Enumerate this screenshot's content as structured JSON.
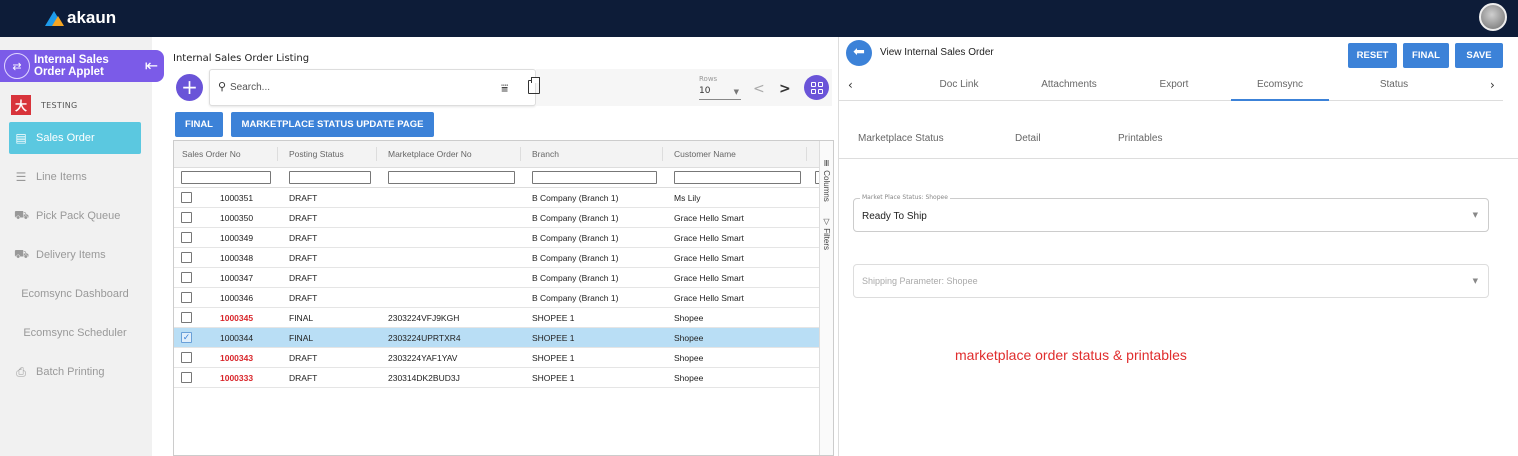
{
  "brand": {
    "name": "akaun"
  },
  "sidebar": {
    "applet_title": "Internal Sales Order Applet",
    "org_label": "TESTING",
    "items": [
      {
        "label": "Sales Order",
        "icon": "document-icon",
        "active": true
      },
      {
        "label": "Line Items",
        "icon": "list-icon"
      },
      {
        "label": "Pick Pack Queue",
        "icon": "truck-icon"
      },
      {
        "label": "Delivery Items",
        "icon": "truck-icon"
      },
      {
        "label": "Ecomsync Dashboard"
      },
      {
        "label": "Ecomsync Scheduler"
      },
      {
        "label": "Batch Printing",
        "icon": "printer-icon"
      }
    ]
  },
  "listing": {
    "title": "Internal Sales Order Listing",
    "search_placeholder": "Search...",
    "rows_label": "Rows",
    "rows_value": "10",
    "buttons": {
      "final": "FINAL",
      "marketplace": "MARKETPLACE STATUS UPDATE PAGE"
    },
    "columns": [
      "Sales Order No",
      "Posting Status",
      "Marketplace Order No",
      "Branch",
      "Customer Name"
    ],
    "side_tabs": {
      "columns": "Columns",
      "filters": "Filters"
    },
    "rows": [
      {
        "so": "1000351",
        "status": "DRAFT",
        "mp": "",
        "branch": "B Company (Branch 1)",
        "customer": "Ms Lily"
      },
      {
        "so": "1000350",
        "status": "DRAFT",
        "mp": "",
        "branch": "B Company (Branch 1)",
        "customer": "Grace Hello Smart"
      },
      {
        "so": "1000349",
        "status": "DRAFT",
        "mp": "",
        "branch": "B Company (Branch 1)",
        "customer": "Grace Hello Smart"
      },
      {
        "so": "1000348",
        "status": "DRAFT",
        "mp": "",
        "branch": "B Company (Branch 1)",
        "customer": "Grace Hello Smart"
      },
      {
        "so": "1000347",
        "status": "DRAFT",
        "mp": "",
        "branch": "B Company (Branch 1)",
        "customer": "Grace Hello Smart"
      },
      {
        "so": "1000346",
        "status": "DRAFT",
        "mp": "",
        "branch": "B Company (Branch 1)",
        "customer": "Grace Hello Smart"
      },
      {
        "so": "1000345",
        "status": "FINAL",
        "mp": "2303224VFJ9KGH",
        "branch": "SHOPEE 1",
        "customer": "Shopee",
        "highlight": true
      },
      {
        "so": "1000344",
        "status": "FINAL",
        "mp": "2303224UPRTXR4",
        "branch": "SHOPEE 1",
        "customer": "Shopee",
        "selected": true
      },
      {
        "so": "1000343",
        "status": "DRAFT",
        "mp": "2303224YAF1YAV",
        "branch": "SHOPEE 1",
        "customer": "Shopee",
        "highlight": true
      },
      {
        "so": "1000333",
        "status": "DRAFT",
        "mp": "230314DK2BUD3J",
        "branch": "SHOPEE 1",
        "customer": "Shopee",
        "highlight": true
      }
    ]
  },
  "detail": {
    "title": "View Internal Sales Order",
    "buttons": {
      "reset": "RESET",
      "final": "FINAL",
      "save": "SAVE"
    },
    "tabs": [
      "Doc Link",
      "Attachments",
      "Export",
      "Ecomsync",
      "Status"
    ],
    "active_tab": "Ecomsync",
    "subtabs": [
      "Marketplace Status",
      "Detail",
      "Printables"
    ],
    "marketplace_status": {
      "legend": "Market Place Status: Shopee",
      "value": "Ready To Ship"
    },
    "shipping_param": {
      "placeholder": "Shipping Parameter: Shopee"
    },
    "annotation": "marketplace order status & printables"
  },
  "colors": {
    "topbar": "#0d1c38",
    "primary": "#3c82d8",
    "accent": "#6a54d8",
    "active_nav": "#5bc8e0",
    "highlight_text": "#d9262b",
    "selected_row": "#b9def5"
  }
}
